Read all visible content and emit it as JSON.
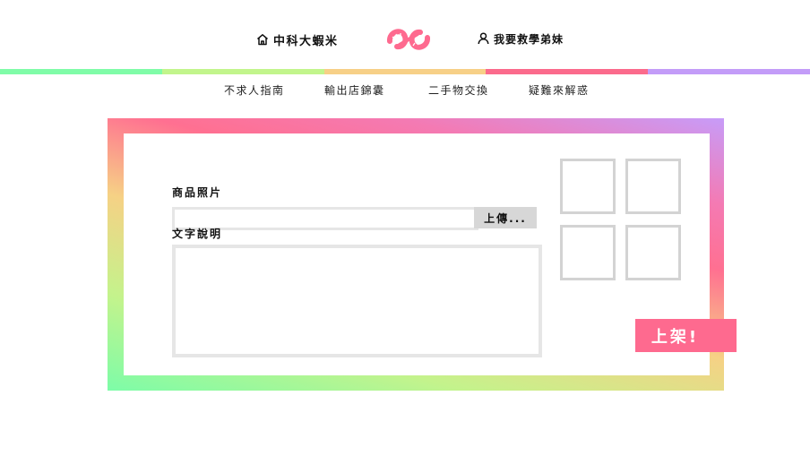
{
  "header": {
    "home_label": "中科大蝦米",
    "user_label": "我要救學弟妹",
    "bar_colors": [
      "#80fca8",
      "#c2f58c",
      "#f7d087",
      "#fb6b8c",
      "#c39cf8"
    ]
  },
  "nav": {
    "items": [
      {
        "label": "不求人指南"
      },
      {
        "label": "輸出店錦囊"
      },
      {
        "label": "二手物交換"
      },
      {
        "label": "疑難來解惑"
      }
    ]
  },
  "form": {
    "photo_label": "商品照片",
    "upload_label": "上傳...",
    "file_value": "",
    "description_label": "文字說明",
    "description_value": "",
    "publish_label": "上架!"
  },
  "colors": {
    "accent": "#fe6a8f",
    "frame_start": "#7dfca8",
    "frame_mid": "#f6d185",
    "frame_end": "#c79cf9"
  }
}
